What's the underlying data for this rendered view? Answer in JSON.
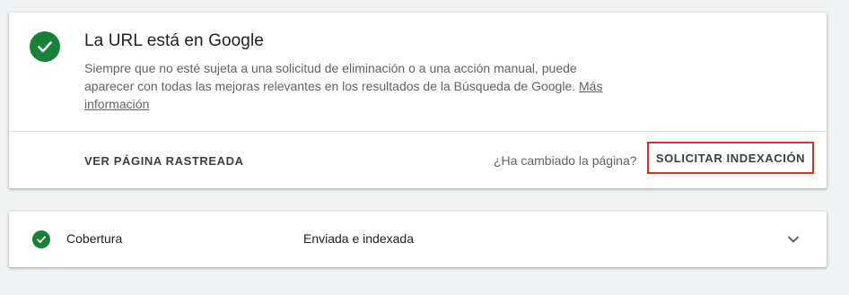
{
  "status_card": {
    "title": "La URL está en Google",
    "description": "Siempre que no esté sujeta a una solicitud de eliminación o a una acción manual, puede aparecer con todas las mejoras relevantes en los resultados de la Búsqueda de Google.",
    "more_link": "Más información",
    "view_crawled_button": "VER PÁGINA RASTREADA",
    "changed_question": "¿Ha cambiado la página?",
    "request_indexing_button": "SOLICITAR INDEXACIÓN",
    "status_color": "#188038",
    "highlight_color": "#d93025"
  },
  "coverage": {
    "label": "Cobertura",
    "value": "Enviada e indexada",
    "status_icon": "check-circle-icon",
    "expand_icon": "chevron-down-icon"
  }
}
